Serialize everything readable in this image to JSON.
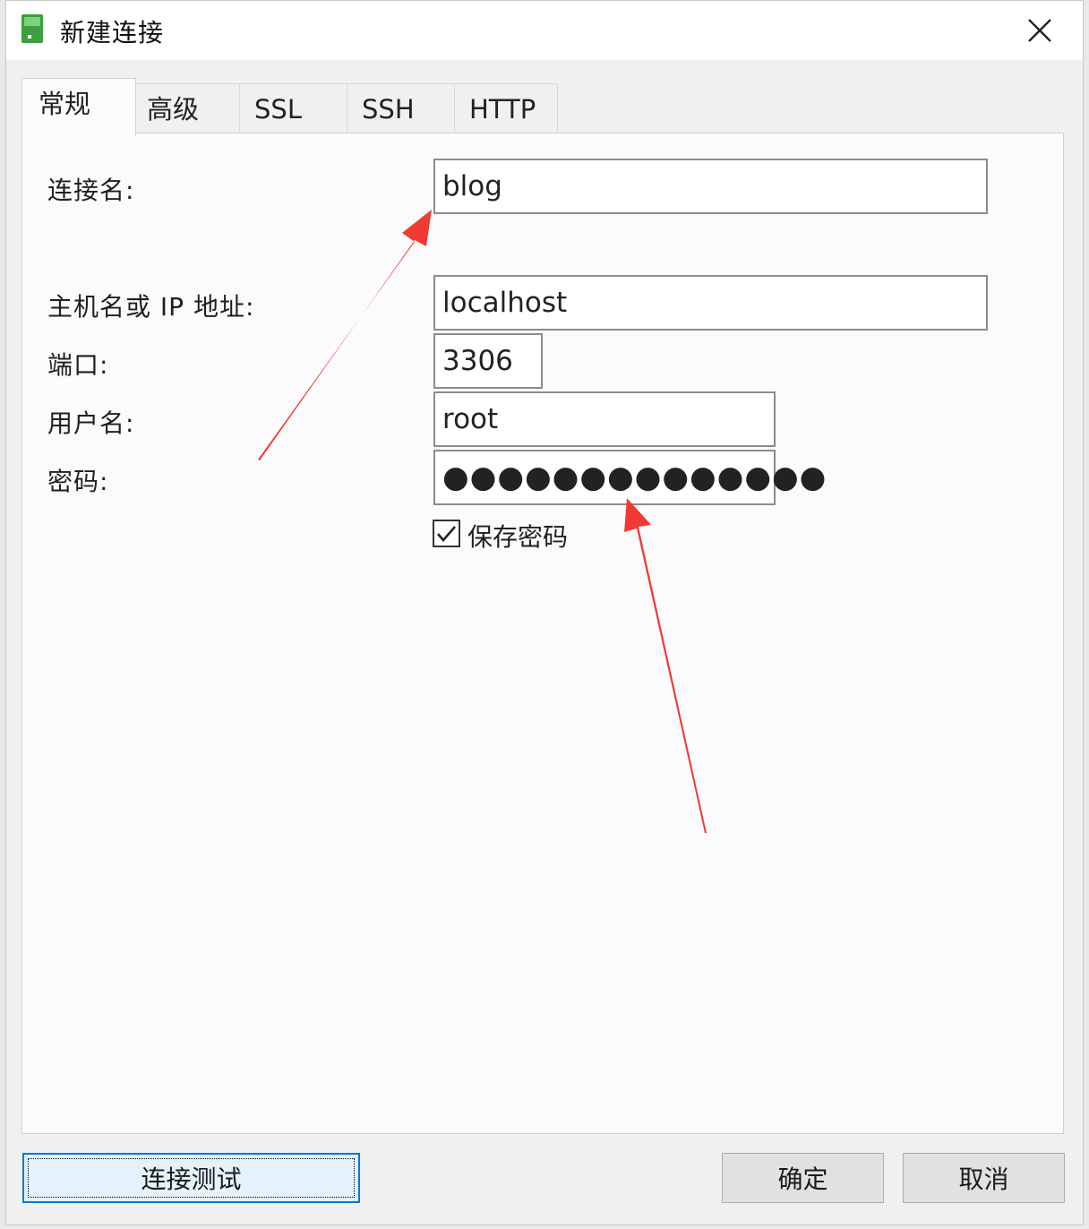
{
  "window": {
    "title": "新建连接",
    "close_icon": "close-icon",
    "app_icon": "navicat-connection-icon"
  },
  "tabs": [
    {
      "label": "常规",
      "active": true
    },
    {
      "label": "高级",
      "active": false
    },
    {
      "label": "SSL",
      "active": false
    },
    {
      "label": "SSH",
      "active": false
    },
    {
      "label": "HTTP",
      "active": false
    }
  ],
  "form": {
    "connection_name": {
      "label": "连接名:",
      "value": "blog"
    },
    "host": {
      "label": "主机名或 IP 地址:",
      "value": "localhost"
    },
    "port": {
      "label": "端口:",
      "value": "3306"
    },
    "username": {
      "label": "用户名:",
      "value": "root"
    },
    "password": {
      "label": "密码:",
      "masked": "●●●●●●●●●●●●●●"
    },
    "save_password": {
      "label": "保存密码",
      "checked": true
    }
  },
  "buttons": {
    "test": "连接测试",
    "ok": "确定",
    "cancel": "取消"
  },
  "colors": {
    "annotation_arrow": "#f03a32",
    "focus_border": "#0078d7",
    "icon_green": "#3c9e3c"
  }
}
